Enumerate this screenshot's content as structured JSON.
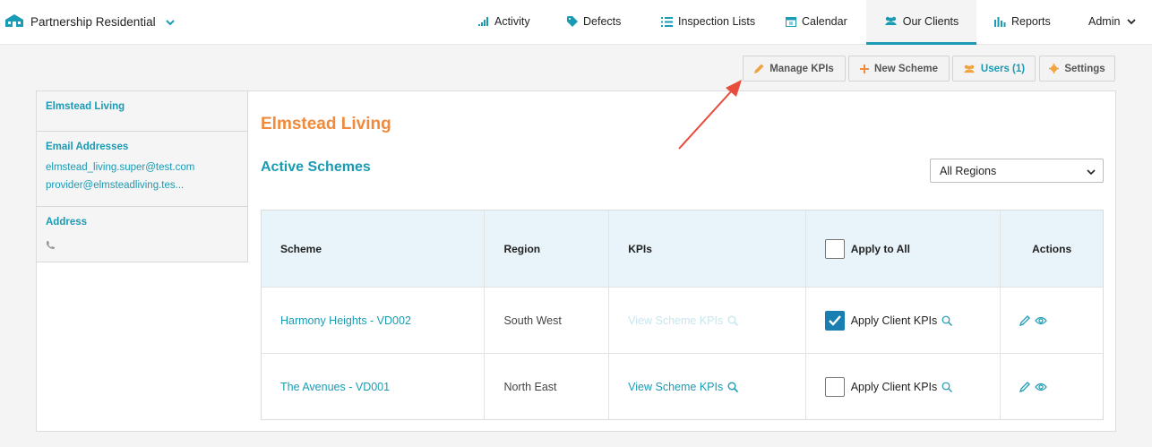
{
  "brand": {
    "name": "Partnership Residential"
  },
  "nav": {
    "activity": "Activity",
    "defects": "Defects",
    "inspection_lists": "Inspection Lists",
    "calendar": "Calendar",
    "our_clients": "Our Clients",
    "reports": "Reports",
    "admin": "Admin"
  },
  "actions": {
    "manage_kpis": "Manage KPIs",
    "new_scheme": "New Scheme",
    "users": "Users (1)",
    "settings": "Settings"
  },
  "sidebar": {
    "client_name": "Elmstead Living",
    "email_heading": "Email Addresses",
    "emails": [
      "elmstead_living.super@test.com",
      "provider@elmsteadliving.tes..."
    ],
    "address_heading": "Address"
  },
  "main": {
    "title": "Elmstead Living",
    "subtitle": "Active Schemes",
    "region_filter": "All Regions"
  },
  "table": {
    "headers": {
      "scheme": "Scheme",
      "region": "Region",
      "kpis": "KPIs",
      "apply_all": "Apply to All",
      "actions": "Actions"
    },
    "rows": [
      {
        "scheme": "Harmony Heights - VD002",
        "region": "South West",
        "kpis": "View Scheme KPIs",
        "kpis_enabled": false,
        "apply": "Apply Client KPIs",
        "checked": true
      },
      {
        "scheme": "The Avenues - VD001",
        "region": "North East",
        "kpis": "View Scheme KPIs",
        "kpis_enabled": true,
        "apply": "Apply Client KPIs",
        "checked": false
      }
    ]
  },
  "colors": {
    "accent": "#1a9bb4",
    "title": "#f08a3c",
    "checkbox": "#1a7fb0",
    "arrow": "#e74c3c"
  },
  "icons": [
    "house-icon",
    "chevron-down-icon",
    "activity-bars-icon",
    "tag-icon",
    "list-icon",
    "calendar-icon",
    "users-icon",
    "bar-chart-icon",
    "pencil-icon",
    "plus-icon",
    "gear-icon",
    "phone-icon",
    "search-icon",
    "eye-icon",
    "checkmark-icon",
    "red-arrow-annotation"
  ]
}
